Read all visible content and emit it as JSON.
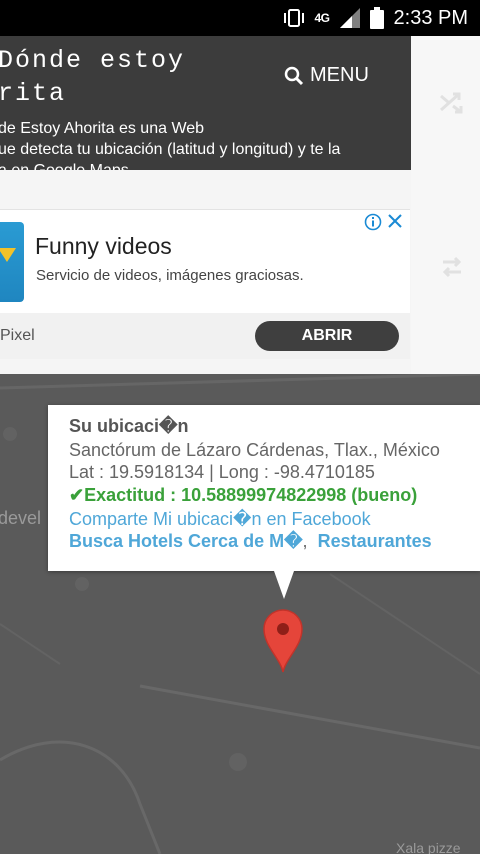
{
  "status_bar": {
    "network": "4G",
    "time": "2:33 PM",
    "icons": [
      "vibrate-icon",
      "signal-icon",
      "battery-icon"
    ]
  },
  "header": {
    "site_title": "Dónde estoy\nrita",
    "menu_label": "MENU",
    "description_line1": "de Estoy Ahorita es una Web",
    "description_line2": "ue detecta tu ubicación (latitud y longitud) y te la",
    "description_line3": "a en Google Maps"
  },
  "ad": {
    "title": "Funny videos",
    "subtitle": "Servicio de videos, imágenes graciosas.",
    "advertiser": "Pixel",
    "button": "ABRIR"
  },
  "info_window": {
    "heading": "Su ubicaci�n",
    "address": "Sanctórum de Lázaro Cárdenas, Tlax., México",
    "coords": "Lat : 19.5918134 | Long : -98.4710185",
    "accuracy": "✔Exactitud : 10.58899974822998 (bueno)",
    "share": "Comparte Mi ubicaci�n en Facebook",
    "hotels": "Busca Hotels Cerca de M�",
    "sep": ",",
    "restaurants": "Restaurantes"
  },
  "map": {
    "label_left": "devel",
    "label_bottom": "Xala pizze"
  },
  "colors": {
    "header_bg": "#3c3c3c",
    "accuracy_green": "#3aa13a",
    "link_blue": "#4fa7d8",
    "pin_red": "#e5453a",
    "map_bg": "#5a5a5a"
  }
}
